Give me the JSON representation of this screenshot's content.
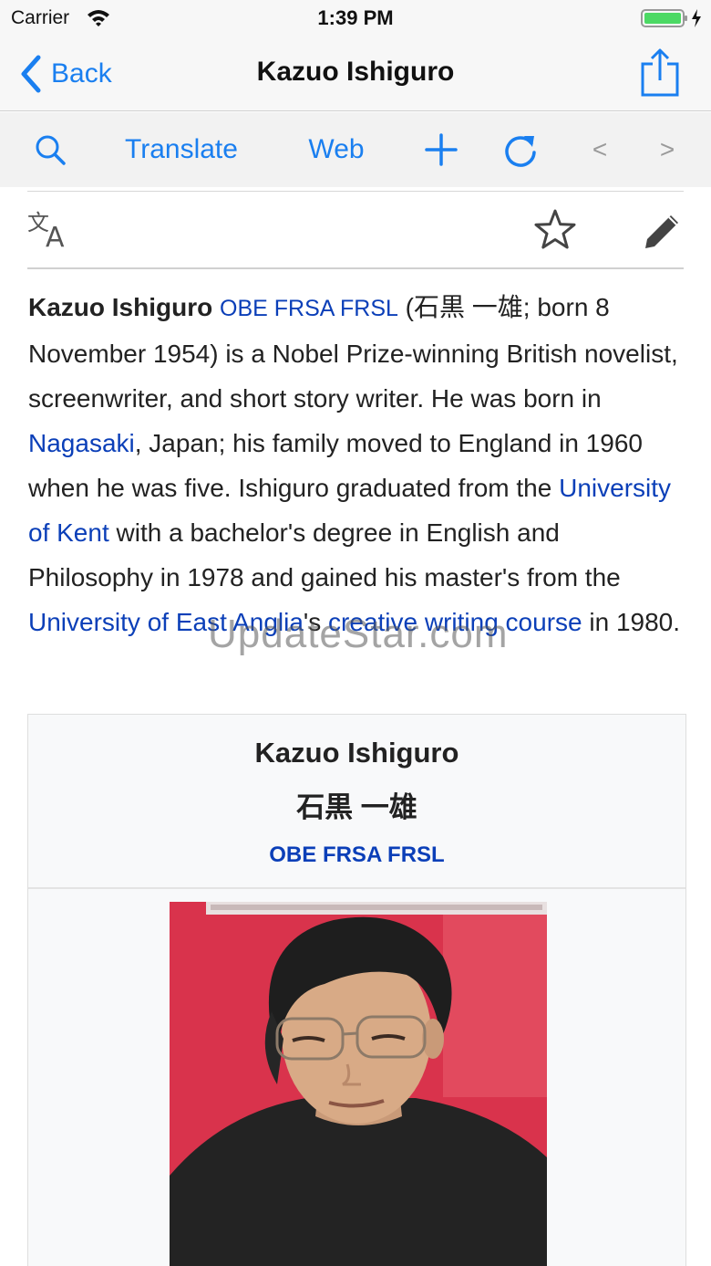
{
  "status_bar": {
    "carrier": "Carrier",
    "time": "1:39 PM",
    "battery_color": "#4cd964"
  },
  "nav": {
    "back_label": "Back",
    "title": "Kazuo Ishiguro"
  },
  "toolbar": {
    "translate_label": "Translate",
    "web_label": "Web",
    "prev_label": "<",
    "next_label": ">"
  },
  "article": {
    "intro": {
      "name": "Kazuo Ishiguro",
      "postnominals": "OBE FRSA FRSL",
      "t1": " (石黒 一雄; born 8 November 1954) is a Nobel Prize-winning British novelist, screenwriter, and short story writer. He was born in ",
      "link_nagasaki": "Nagasaki",
      "t2": ", Japan; his family moved to England in 1960 when he was five. Ishiguro graduated from the ",
      "link_kent": "University of Kent",
      "t3": " with a bachelor's degree in English and Philosophy in 1978 and gained his master's from the ",
      "link_uea": "University of East Anglia",
      "t4": "'s ",
      "link_course": "creative writing course",
      "t5": " in 1980."
    },
    "watermark": "UpdateStar.com"
  },
  "infobox": {
    "name": "Kazuo Ishiguro",
    "native_name": "石黒 一雄",
    "postnominals": "OBE FRSA FRSL"
  },
  "colors": {
    "accent": "#1a7ff0",
    "link": "#0b3fb8",
    "portrait_background": "#d9334c"
  }
}
